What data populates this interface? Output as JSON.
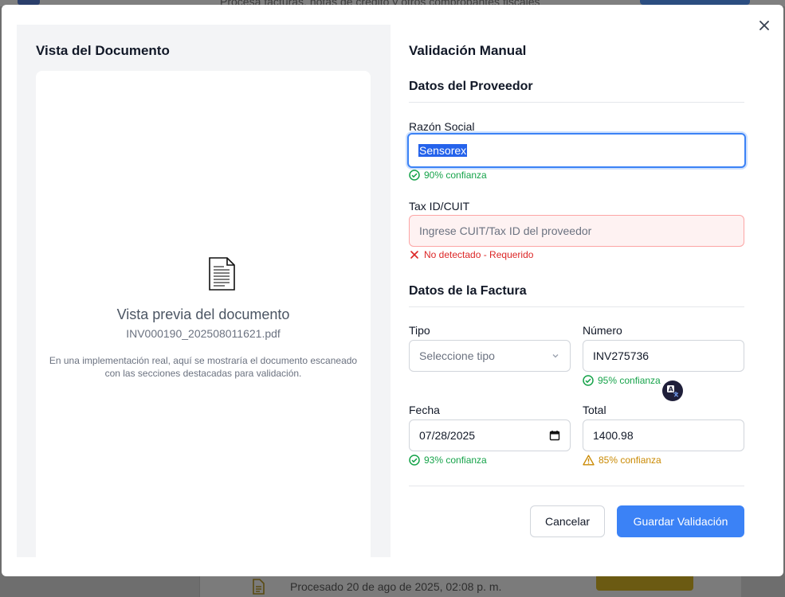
{
  "backdrop": {
    "subtitle": "Procesa facturas, notas de crédito y otros comprobantes fiscales",
    "processed_text": "Procesado 20 de ago de 2025, 02:08 p. m."
  },
  "modal": {
    "close_label": "×",
    "left": {
      "title": "Vista del Documento",
      "preview_title": "Vista previa del documento",
      "file_name": "INV000190_202508011621.pdf",
      "note_line1": "En una implementación real, aquí se mostraría el documento escaneado",
      "note_line2": "con las secciones destacadas para validación."
    },
    "right": {
      "title": "Validación Manual",
      "supplier": {
        "section_title": "Datos del Proveedor",
        "razon_social": {
          "label": "Razón Social",
          "value": "Sensorex",
          "status": "90% confianza"
        },
        "tax_id": {
          "label": "Tax ID/CUIT",
          "placeholder": "Ingrese CUIT/Tax ID del proveedor",
          "status": "No detectado - Requerido"
        }
      },
      "invoice": {
        "section_title": "Datos de la Factura",
        "tipo": {
          "label": "Tipo",
          "placeholder": "Seleccione tipo"
        },
        "numero": {
          "label": "Número",
          "value": "INV275736",
          "status": "95% confianza"
        },
        "fecha": {
          "label": "Fecha",
          "value": "07/28/2025",
          "status": "93% confianza"
        },
        "total": {
          "label": "Total",
          "value": "1400.98",
          "status": "85% confianza"
        }
      },
      "actions": {
        "cancel": "Cancelar",
        "save": "Guardar Validación"
      }
    }
  },
  "colors": {
    "primary": "#3b82f6",
    "success": "#16a34a",
    "error": "#dc2626",
    "warning": "#ca8a04"
  }
}
